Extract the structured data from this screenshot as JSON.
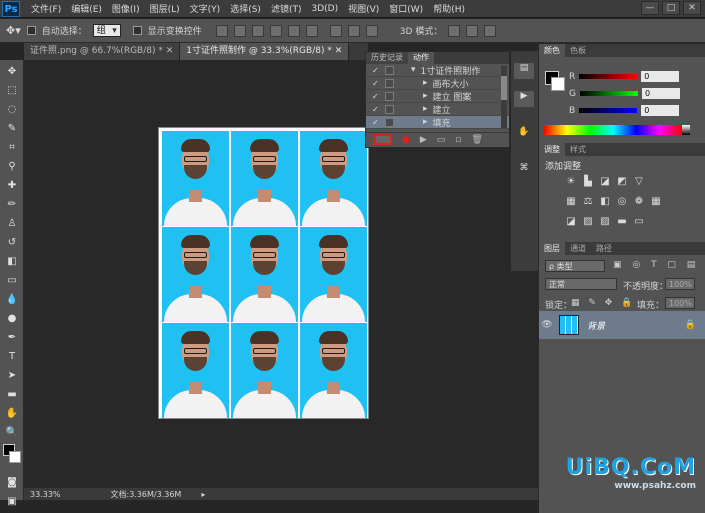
{
  "app": {
    "logo": "Ps"
  },
  "menu": [
    "文件(F)",
    "编辑(E)",
    "图像(I)",
    "图层(L)",
    "文字(Y)",
    "选择(S)",
    "滤镜(T)",
    "3D(D)",
    "视图(V)",
    "窗口(W)",
    "帮助(H)"
  ],
  "window_controls": [
    "—",
    "□",
    "✕"
  ],
  "options": {
    "auto_select_label": "自动选择：",
    "auto_select_value": "组",
    "show_transform_label": "显示变换控件",
    "mode_3d": "3D 模式："
  },
  "doc_tabs": [
    {
      "label": "证件照.png @ 66.7%(RGB/8) *  ✕"
    },
    {
      "label": "1寸证件照制作 @ 33.3%(RGB/8) *  ✕"
    }
  ],
  "history_panel": {
    "tabs": [
      "历史记录",
      "动作"
    ],
    "actions": [
      "1寸证件照制作",
      "画布大小",
      "建立 图案",
      "建立",
      "填充"
    ]
  },
  "color_panel": {
    "tabs": [
      "颜色",
      "色板"
    ],
    "r": "0",
    "g": "0",
    "b": "0",
    "r_label": "R",
    "g_label": "G",
    "b_label": "B"
  },
  "adjust_panel": {
    "tabs": [
      "调整",
      "样式"
    ],
    "title": "添加调整"
  },
  "layers_panel": {
    "tabs": [
      "图层",
      "通道",
      "路径"
    ],
    "kind": "ρ 类型",
    "blend": "正常",
    "opacity_label": "不透明度：",
    "opacity": "100%",
    "lock_label": "锁定：",
    "fill_label": "填充：",
    "fill": "100%",
    "layer_name": "背景"
  },
  "status": {
    "zoom": "33.33%",
    "doc": "文档:3.36M/3.36M"
  },
  "watermark": {
    "text": "UiBQ.CoM",
    "sub": "www.psahz.com"
  },
  "colors": {
    "photo_bg": "#20c0f2",
    "menubar": "#3c3c3c",
    "panel": "#535353"
  }
}
